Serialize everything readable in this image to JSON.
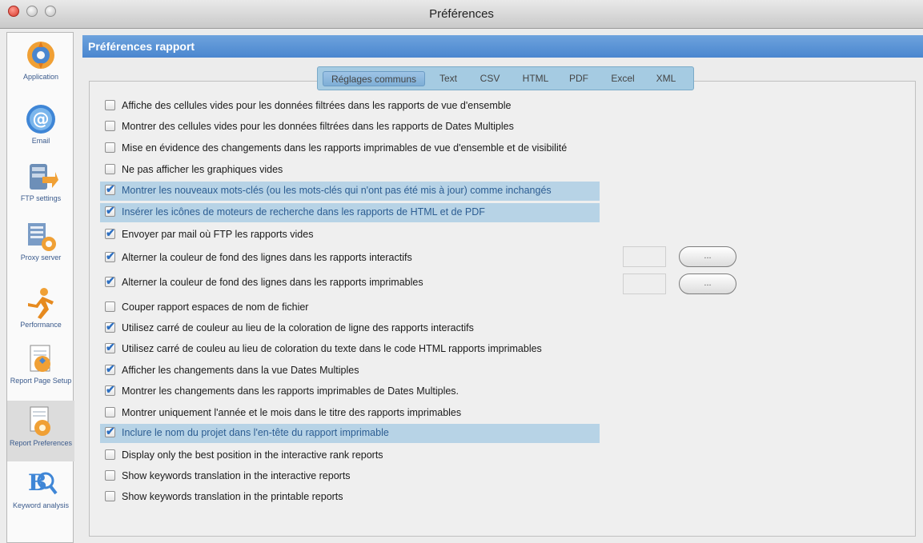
{
  "window": {
    "title": "Préférences"
  },
  "sidebar": {
    "items": [
      {
        "label": "Application",
        "icon": "application-icon"
      },
      {
        "label": "Email",
        "icon": "email-icon"
      },
      {
        "label": "FTP settings",
        "icon": "ftp-icon"
      },
      {
        "label": "Proxy server",
        "icon": "proxy-icon"
      },
      {
        "label": "Performance",
        "icon": "performance-icon"
      },
      {
        "label": "Report Page Setup",
        "icon": "page-setup-icon"
      },
      {
        "label": "Report Preferences",
        "icon": "report-preferences-icon",
        "selected": true
      },
      {
        "label": "Keyword analysis",
        "icon": "keyword-analysis-icon"
      }
    ]
  },
  "header": {
    "title": "Préférences rapport"
  },
  "tabs": [
    {
      "label": "Réglages communs",
      "active": true
    },
    {
      "label": "Text"
    },
    {
      "label": "CSV"
    },
    {
      "label": "HTML"
    },
    {
      "label": "PDF"
    },
    {
      "label": "Excel"
    },
    {
      "label": "XML"
    }
  ],
  "options": [
    {
      "label": "Affiche des cellules vides pour les données filtrées dans les rapports de vue d'ensemble",
      "checked": false
    },
    {
      "label": "Montrer des cellules vides pour les données filtrées dans les rapports de Dates Multiples",
      "checked": false
    },
    {
      "label": "Mise en évidence des changements dans les rapports imprimables de vue d'ensemble et de visibilité",
      "checked": false
    },
    {
      "label": "Ne pas afficher les graphiques vides",
      "checked": false
    },
    {
      "label": "Montrer les nouveaux mots-clés (ou les mots-clés qui n'ont pas été mis à jour) comme inchangés",
      "checked": true,
      "highlight": true
    },
    {
      "label": "Insérer les icônes de moteurs de recherche dans les rapports de HTML et de PDF",
      "checked": true,
      "highlight": true
    },
    {
      "label": "Envoyer par mail où FTP les rapports vides",
      "checked": true
    },
    {
      "label": "Alterner la couleur de fond des lignes dans les rapports interactifs",
      "checked": true
    },
    {
      "label": "Alterner la couleur de fond des lignes dans les rapports imprimables",
      "checked": true
    },
    {
      "label": "Couper rapport espaces de nom de fichier",
      "checked": false
    },
    {
      "label": "Utilisez carré de couleur au lieu de la coloration de ligne des rapports interactifs",
      "checked": true
    },
    {
      "label": "Utilisez carré de couleu au lieu de coloration du texte dans le code HTML rapports imprimables",
      "checked": true
    },
    {
      "label": "Afficher les changements dans la vue Dates Multiples",
      "checked": true
    },
    {
      "label": "Montrer les changements dans les rapports imprimables de Dates Multiples.",
      "checked": true
    },
    {
      "label": "Montrer uniquement l'année et le mois dans le titre des rapports imprimables",
      "checked": false
    },
    {
      "label": "Inclure le nom du projet dans l'en-tête du rapport imprimable",
      "checked": true,
      "highlight": true
    },
    {
      "label": "Display only the best position in the interactive rank reports",
      "checked": false
    },
    {
      "label": "Show keywords translation in the interactive reports",
      "checked": false
    },
    {
      "label": "Show keywords translation in the printable reports",
      "checked": false
    }
  ],
  "color_pickers": {
    "interactive_button_label": "...",
    "printable_button_label": "..."
  }
}
